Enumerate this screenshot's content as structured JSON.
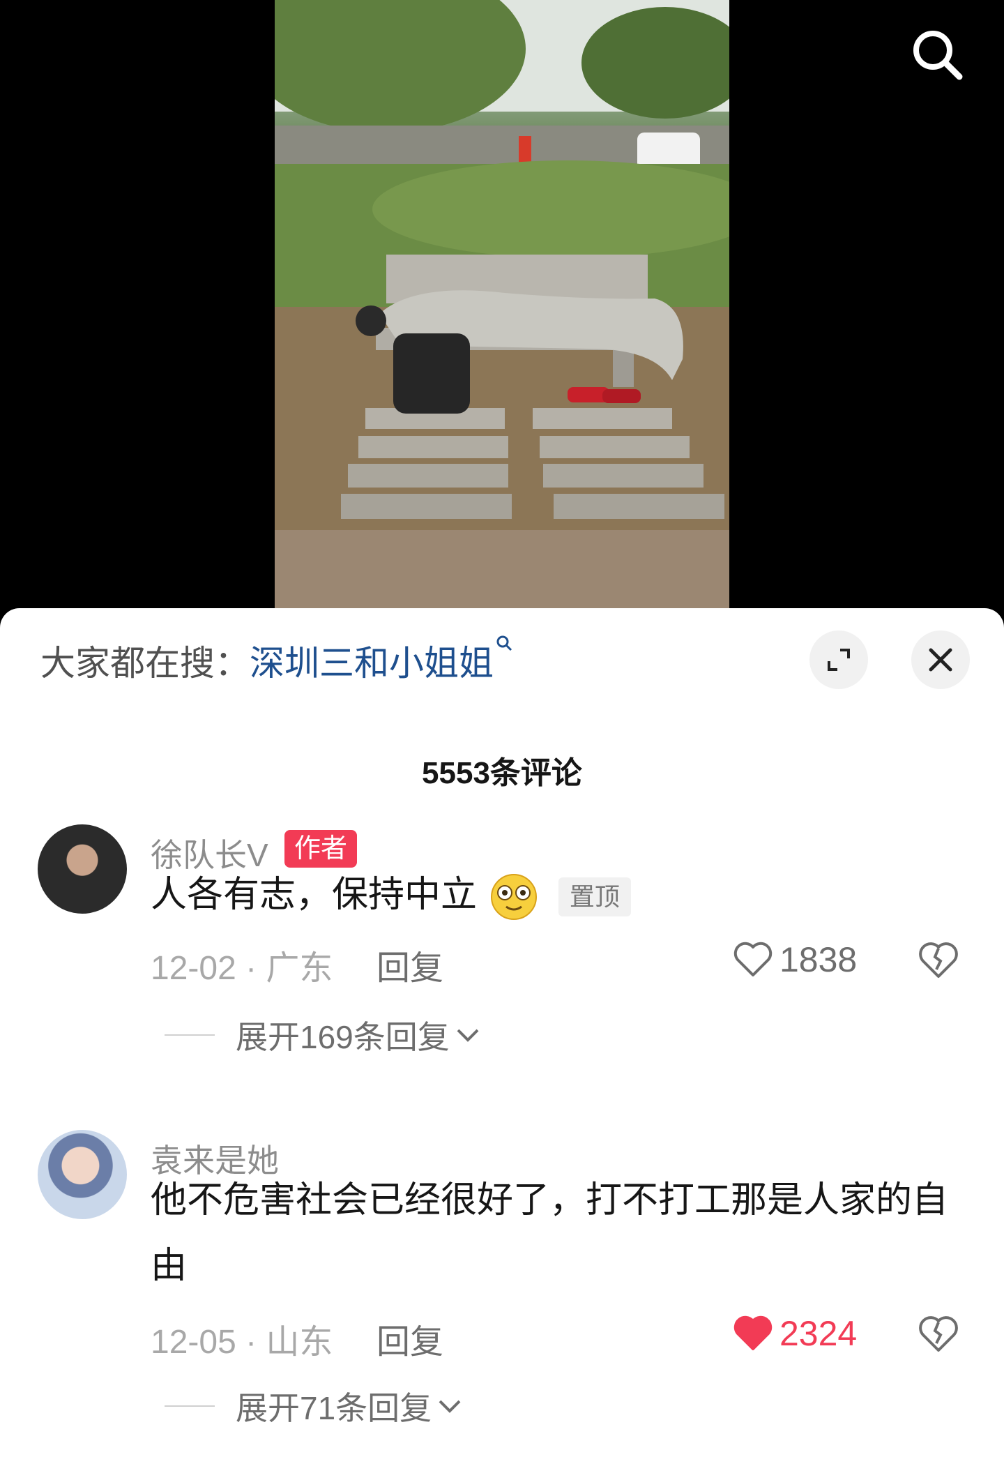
{
  "header": {
    "search_icon": "search-icon"
  },
  "hot_search": {
    "prefix": "大家都在搜：",
    "term": "深圳三和小姐姐",
    "term_icon": "search-small-icon"
  },
  "sheet_controls": {
    "expand_icon": "expand-icon",
    "close_icon": "close-icon"
  },
  "comments_header": {
    "count_label": "5553条评论"
  },
  "comments": [
    {
      "username": "徐队长V",
      "badge": "作者",
      "text": "人各有志，保持中立",
      "emoji": "drooling-face-emoji",
      "pin_label": "置顶",
      "date_location": "12-02 · 广东",
      "reply_label": "回复",
      "like_count": "1838",
      "liked": false,
      "expand_label": "展开169条回复"
    },
    {
      "username": "袁来是她",
      "text": "他不危害社会已经很好了，打不打工那是人家的自由",
      "date_location": "12-05 · 山东",
      "reply_label": "回复",
      "like_count": "2324",
      "liked": true,
      "expand_label": "展开71条回复"
    }
  ],
  "colors": {
    "like_active": "#f23b55",
    "badge_bg": "#f23b55",
    "hot_term": "#1e4f8e"
  }
}
